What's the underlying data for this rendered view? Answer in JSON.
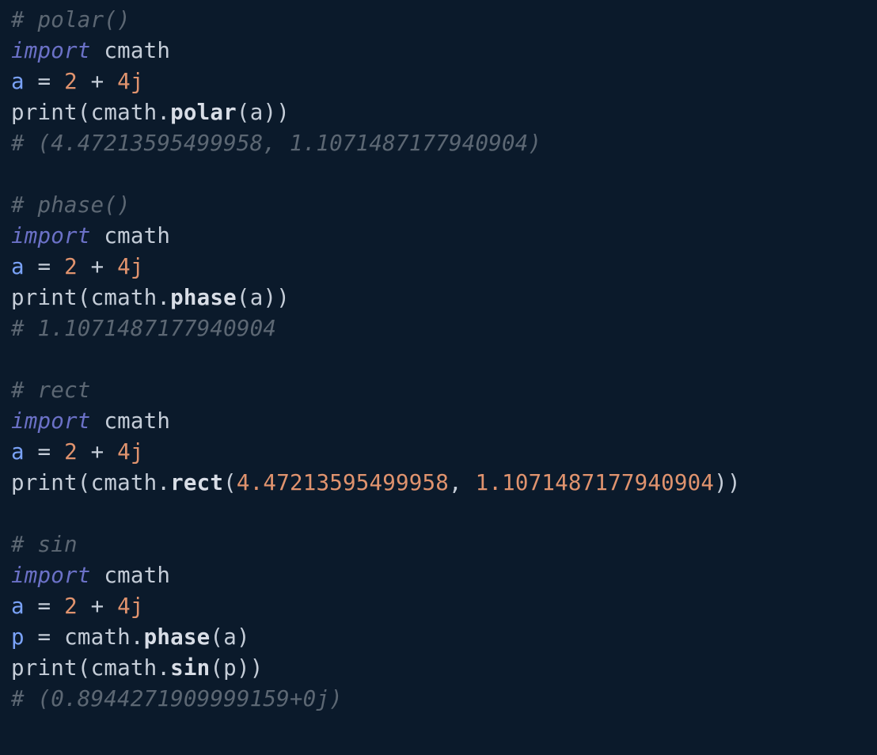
{
  "lines": {
    "l1": {
      "c1": "# polar()"
    },
    "l2": {
      "kw": "import",
      "sp": " ",
      "mod": "cmath"
    },
    "l3": {
      "v": "a",
      "sp1": " ",
      "eq": "=",
      "sp2": " ",
      "n1": "2",
      "sp3": " ",
      "pl": "+",
      "sp4": " ",
      "n2": "4j"
    },
    "l4": {
      "p": "print",
      "o": "(",
      "m": "cmath",
      "d": ".",
      "f": "polar",
      "o2": "(",
      "a": "a",
      "c": ")",
      "c2": ")"
    },
    "l5": {
      "c": "# (4.47213595499958, 1.1071487177940904)"
    },
    "l6": {
      "blank": ""
    },
    "l7": {
      "c": "# phase()"
    },
    "l8": {
      "kw": "import",
      "sp": " ",
      "mod": "cmath"
    },
    "l9": {
      "v": "a",
      "sp1": " ",
      "eq": "=",
      "sp2": " ",
      "n1": "2",
      "sp3": " ",
      "pl": "+",
      "sp4": " ",
      "n2": "4j"
    },
    "l10": {
      "p": "print",
      "o": "(",
      "m": "cmath",
      "d": ".",
      "f": "phase",
      "o2": "(",
      "a": "a",
      "c": ")",
      "c2": ")"
    },
    "l11": {
      "c": "# 1.1071487177940904"
    },
    "l12": {
      "blank": ""
    },
    "l13": {
      "c": "# rect"
    },
    "l14": {
      "kw": "import",
      "sp": " ",
      "mod": "cmath"
    },
    "l15": {
      "v": "a",
      "sp1": " ",
      "eq": "=",
      "sp2": " ",
      "n1": "2",
      "sp3": " ",
      "pl": "+",
      "sp4": " ",
      "n2": "4j"
    },
    "l16": {
      "p": "print",
      "o": "(",
      "m": "cmath",
      "d": ".",
      "f": "rect",
      "o2": "(",
      "n1": "4.47213595499958",
      "cm": ",",
      "sp": " ",
      "n2": "1.1071487177940904",
      "c": ")",
      "c2": ")"
    },
    "l17": {
      "blank": ""
    },
    "l18": {
      "c": "# sin"
    },
    "l19": {
      "kw": "import",
      "sp": " ",
      "mod": "cmath"
    },
    "l20": {
      "v": "a",
      "sp1": " ",
      "eq": "=",
      "sp2": " ",
      "n1": "2",
      "sp3": " ",
      "pl": "+",
      "sp4": " ",
      "n2": "4j"
    },
    "l21": {
      "v": "p",
      "sp1": " ",
      "eq": "=",
      "sp2": " ",
      "m": "cmath",
      "d": ".",
      "f": "phase",
      "o": "(",
      "a": "a",
      "c": ")"
    },
    "l22": {
      "p": "print",
      "o": "(",
      "m": "cmath",
      "d": ".",
      "f": "sin",
      "o2": "(",
      "a": "p",
      "c": ")",
      "c2": ")"
    },
    "l23": {
      "c": "# (0.8944271909999159+0j)"
    }
  }
}
